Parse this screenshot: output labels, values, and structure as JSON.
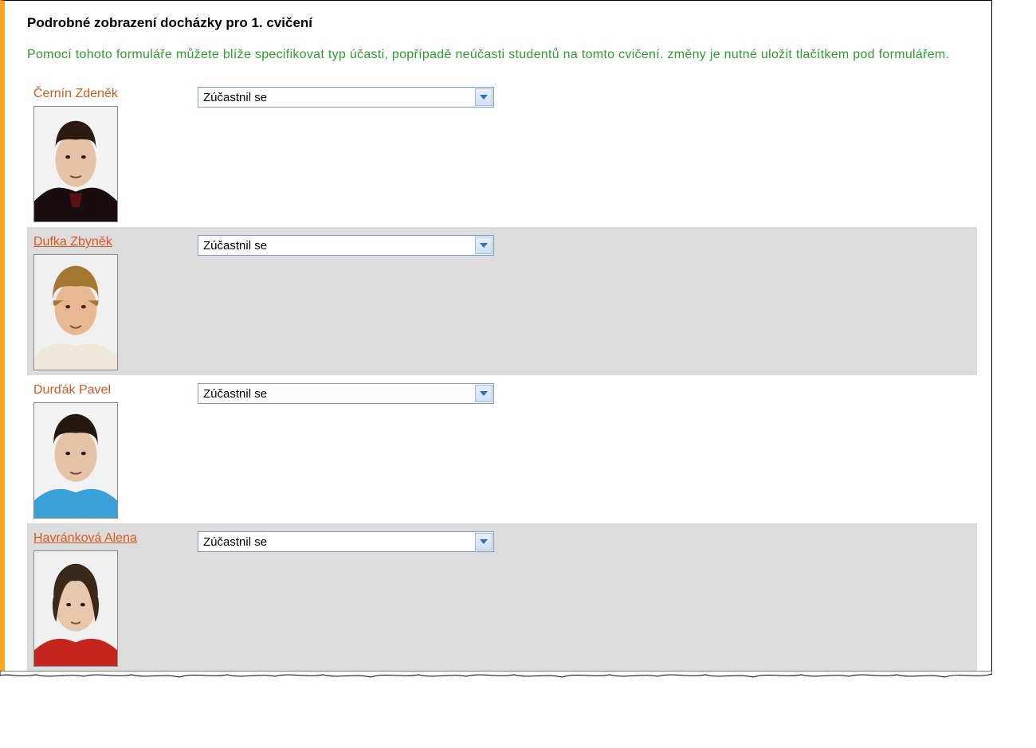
{
  "title": "Podrobné zobrazení docházky pro 1. cvičení",
  "hint": "Pomocí tohoto formuláře můžete blíže specifikovat typ účasti, popřípadě neúčasti studentů na tomto cvičení. změny je nutné uložit tlačítkem pod formulářem.",
  "select_value": "Zúčastnil se",
  "students": [
    {
      "name": "Černín Zdeněk",
      "alt": false
    },
    {
      "name": "Dufka Zbyněk",
      "alt": true
    },
    {
      "name": "Durďák Pavel",
      "alt": false
    },
    {
      "name": "Havránková Alena",
      "alt": true
    }
  ]
}
